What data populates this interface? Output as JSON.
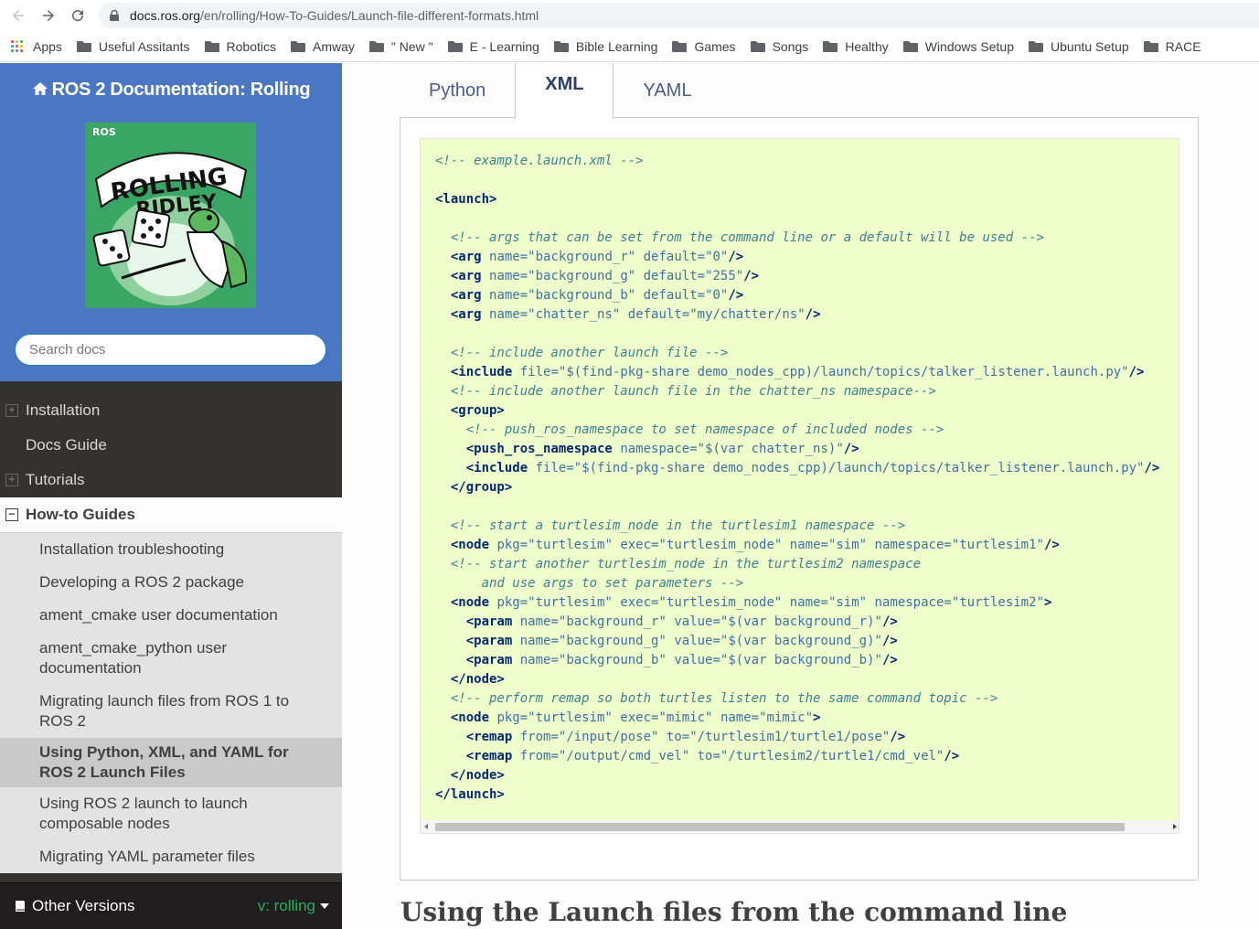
{
  "browser": {
    "url_host": "docs.ros.org",
    "url_path": "/en/rolling/How-To-Guides/Launch-file-different-formats.html"
  },
  "bookmarks": [
    {
      "label": "Apps",
      "icon": "apps-grid-icon"
    },
    {
      "label": "Useful Assitants",
      "icon": "folder-icon"
    },
    {
      "label": "Robotics",
      "icon": "folder-icon"
    },
    {
      "label": "Amway",
      "icon": "folder-icon"
    },
    {
      "label": "\" New \"",
      "icon": "folder-icon"
    },
    {
      "label": "E - Learning",
      "icon": "folder-icon"
    },
    {
      "label": "Bible Learning",
      "icon": "folder-icon"
    },
    {
      "label": "Games",
      "icon": "folder-icon"
    },
    {
      "label": "Songs",
      "icon": "folder-icon"
    },
    {
      "label": "Healthy",
      "icon": "folder-icon"
    },
    {
      "label": "Windows Setup",
      "icon": "folder-icon"
    },
    {
      "label": "Ubuntu Setup",
      "icon": "folder-icon"
    },
    {
      "label": "RACE",
      "icon": "folder-icon"
    }
  ],
  "sidebar": {
    "project_title": "ROS 2 Documentation: Rolling",
    "logo_text": {
      "brand": "ROS",
      "line1": "ROLLING",
      "line2": "RIDLEY"
    },
    "search_placeholder": "Search docs",
    "menu": [
      {
        "label": "Installation",
        "expandable": true
      },
      {
        "label": "Docs Guide",
        "expandable": false
      },
      {
        "label": "Tutorials",
        "expandable": true
      }
    ],
    "current": {
      "label": "How-to Guides",
      "items": [
        {
          "label": "Installation troubleshooting"
        },
        {
          "label": "Developing a ROS 2 package"
        },
        {
          "label": "ament_cmake user documentation"
        },
        {
          "label": "ament_cmake_python user documentation"
        },
        {
          "label": "Migrating launch files from ROS 1 to ROS 2"
        },
        {
          "label": "Using Python, XML, and YAML for ROS 2 Launch Files",
          "active": true
        },
        {
          "label": "Using ROS 2 launch to launch composable nodes"
        },
        {
          "label": "Migrating YAML parameter files"
        }
      ]
    },
    "versions": {
      "label": "Other Versions",
      "current": "v: rolling"
    }
  },
  "main": {
    "tabs": [
      {
        "label": "Python",
        "selected": false
      },
      {
        "label": "XML",
        "selected": true
      },
      {
        "label": "YAML",
        "selected": false
      }
    ],
    "code_lines": [
      [
        [
          "c",
          "<!-- example.launch.xml -->"
        ]
      ],
      [],
      [
        [
          "t",
          "<launch>"
        ]
      ],
      [],
      [
        [
          "",
          "  "
        ],
        [
          "c",
          "<!-- args that can be set from the command line or a default will be used -->"
        ]
      ],
      [
        [
          "",
          "  "
        ],
        [
          "t",
          "<arg"
        ],
        [
          "",
          " "
        ],
        [
          "a",
          "name="
        ],
        [
          "n",
          "\"background_r\""
        ],
        [
          "",
          " "
        ],
        [
          "a",
          "default="
        ],
        [
          "n",
          "\"0\""
        ],
        [
          "t",
          "/>"
        ]
      ],
      [
        [
          "",
          "  "
        ],
        [
          "t",
          "<arg"
        ],
        [
          "",
          " "
        ],
        [
          "a",
          "name="
        ],
        [
          "n",
          "\"background_g\""
        ],
        [
          "",
          " "
        ],
        [
          "a",
          "default="
        ],
        [
          "n",
          "\"255\""
        ],
        [
          "t",
          "/>"
        ]
      ],
      [
        [
          "",
          "  "
        ],
        [
          "t",
          "<arg"
        ],
        [
          "",
          " "
        ],
        [
          "a",
          "name="
        ],
        [
          "n",
          "\"background_b\""
        ],
        [
          "",
          " "
        ],
        [
          "a",
          "default="
        ],
        [
          "n",
          "\"0\""
        ],
        [
          "t",
          "/>"
        ]
      ],
      [
        [
          "",
          "  "
        ],
        [
          "t",
          "<arg"
        ],
        [
          "",
          " "
        ],
        [
          "a",
          "name="
        ],
        [
          "n",
          "\"chatter_ns\""
        ],
        [
          "",
          " "
        ],
        [
          "a",
          "default="
        ],
        [
          "n",
          "\"my/chatter/ns\""
        ],
        [
          "t",
          "/>"
        ]
      ],
      [],
      [
        [
          "",
          "  "
        ],
        [
          "c",
          "<!-- include another launch file -->"
        ]
      ],
      [
        [
          "",
          "  "
        ],
        [
          "t",
          "<include"
        ],
        [
          "",
          " "
        ],
        [
          "a",
          "file="
        ],
        [
          "n",
          "\"$(find-pkg-share demo_nodes_cpp)/launch/topics/talker_listener.launch.py\""
        ],
        [
          "t",
          "/>"
        ]
      ],
      [
        [
          "",
          "  "
        ],
        [
          "c",
          "<!-- include another launch file in the chatter_ns namespace-->"
        ]
      ],
      [
        [
          "",
          "  "
        ],
        [
          "t",
          "<group>"
        ]
      ],
      [
        [
          "",
          "    "
        ],
        [
          "c",
          "<!-- push_ros_namespace to set namespace of included nodes -->"
        ]
      ],
      [
        [
          "",
          "    "
        ],
        [
          "t",
          "<push_ros_namespace"
        ],
        [
          "",
          " "
        ],
        [
          "a",
          "namespace="
        ],
        [
          "n",
          "\"$(var chatter_ns)\""
        ],
        [
          "t",
          "/>"
        ]
      ],
      [
        [
          "",
          "    "
        ],
        [
          "t",
          "<include"
        ],
        [
          "",
          " "
        ],
        [
          "a",
          "file="
        ],
        [
          "n",
          "\"$(find-pkg-share demo_nodes_cpp)/launch/topics/talker_listener.launch.py\""
        ],
        [
          "t",
          "/>"
        ]
      ],
      [
        [
          "",
          "  "
        ],
        [
          "t",
          "</group>"
        ]
      ],
      [],
      [
        [
          "",
          "  "
        ],
        [
          "c",
          "<!-- start a turtlesim_node in the turtlesim1 namespace -->"
        ]
      ],
      [
        [
          "",
          "  "
        ],
        [
          "t",
          "<node"
        ],
        [
          "",
          " "
        ],
        [
          "a",
          "pkg="
        ],
        [
          "n",
          "\"turtlesim\""
        ],
        [
          "",
          " "
        ],
        [
          "a",
          "exec="
        ],
        [
          "n",
          "\"turtlesim_node\""
        ],
        [
          "",
          " "
        ],
        [
          "a",
          "name="
        ],
        [
          "n",
          "\"sim\""
        ],
        [
          "",
          " "
        ],
        [
          "a",
          "namespace="
        ],
        [
          "n",
          "\"turtlesim1\""
        ],
        [
          "t",
          "/>"
        ]
      ],
      [
        [
          "",
          "  "
        ],
        [
          "c",
          "<!-- start another turtlesim_node in the turtlesim2 namespace"
        ]
      ],
      [
        [
          "",
          "      "
        ],
        [
          "c",
          "and use args to set parameters -->"
        ]
      ],
      [
        [
          "",
          "  "
        ],
        [
          "t",
          "<node"
        ],
        [
          "",
          " "
        ],
        [
          "a",
          "pkg="
        ],
        [
          "n",
          "\"turtlesim\""
        ],
        [
          "",
          " "
        ],
        [
          "a",
          "exec="
        ],
        [
          "n",
          "\"turtlesim_node\""
        ],
        [
          "",
          " "
        ],
        [
          "a",
          "name="
        ],
        [
          "n",
          "\"sim\""
        ],
        [
          "",
          " "
        ],
        [
          "a",
          "namespace="
        ],
        [
          "n",
          "\"turtlesim2\""
        ],
        [
          "t",
          ">"
        ]
      ],
      [
        [
          "",
          "    "
        ],
        [
          "t",
          "<param"
        ],
        [
          "",
          " "
        ],
        [
          "a",
          "name="
        ],
        [
          "n",
          "\"background_r\""
        ],
        [
          "",
          " "
        ],
        [
          "a",
          "value="
        ],
        [
          "n",
          "\"$(var background_r)\""
        ],
        [
          "t",
          "/>"
        ]
      ],
      [
        [
          "",
          "    "
        ],
        [
          "t",
          "<param"
        ],
        [
          "",
          " "
        ],
        [
          "a",
          "name="
        ],
        [
          "n",
          "\"background_g\""
        ],
        [
          "",
          " "
        ],
        [
          "a",
          "value="
        ],
        [
          "n",
          "\"$(var background_g)\""
        ],
        [
          "t",
          "/>"
        ]
      ],
      [
        [
          "",
          "    "
        ],
        [
          "t",
          "<param"
        ],
        [
          "",
          " "
        ],
        [
          "a",
          "name="
        ],
        [
          "n",
          "\"background_b\""
        ],
        [
          "",
          " "
        ],
        [
          "a",
          "value="
        ],
        [
          "n",
          "\"$(var background_b)\""
        ],
        [
          "t",
          "/>"
        ]
      ],
      [
        [
          "",
          "  "
        ],
        [
          "t",
          "</node>"
        ]
      ],
      [
        [
          "",
          "  "
        ],
        [
          "c",
          "<!-- perform remap so both turtles listen to the same command topic -->"
        ]
      ],
      [
        [
          "",
          "  "
        ],
        [
          "t",
          "<node"
        ],
        [
          "",
          " "
        ],
        [
          "a",
          "pkg="
        ],
        [
          "n",
          "\"turtlesim\""
        ],
        [
          "",
          " "
        ],
        [
          "a",
          "exec="
        ],
        [
          "n",
          "\"mimic\""
        ],
        [
          "",
          " "
        ],
        [
          "a",
          "name="
        ],
        [
          "n",
          "\"mimic\""
        ],
        [
          "t",
          ">"
        ]
      ],
      [
        [
          "",
          "    "
        ],
        [
          "t",
          "<remap"
        ],
        [
          "",
          " "
        ],
        [
          "a",
          "from="
        ],
        [
          "n",
          "\"/input/pose\""
        ],
        [
          "",
          " "
        ],
        [
          "a",
          "to="
        ],
        [
          "n",
          "\"/turtlesim1/turtle1/pose\""
        ],
        [
          "t",
          "/>"
        ]
      ],
      [
        [
          "",
          "    "
        ],
        [
          "t",
          "<remap"
        ],
        [
          "",
          " "
        ],
        [
          "a",
          "from="
        ],
        [
          "n",
          "\"/output/cmd_vel\""
        ],
        [
          "",
          " "
        ],
        [
          "a",
          "to="
        ],
        [
          "n",
          "\"/turtlesim2/turtle1/cmd_vel\""
        ],
        [
          "t",
          "/>"
        ]
      ],
      [
        [
          "",
          "  "
        ],
        [
          "t",
          "</node>"
        ]
      ],
      [
        [
          "t",
          "</launch>"
        ]
      ]
    ],
    "section_heading": "Using the Launch files from the command line"
  },
  "colors": {
    "sidebar_top": "#4a76c4",
    "sidebar_bg": "#343131",
    "code_bg": "#eeffcc",
    "comment": "#408090",
    "tag": "#062873",
    "attr": "#4070a0",
    "version_accent": "#27ae60"
  }
}
